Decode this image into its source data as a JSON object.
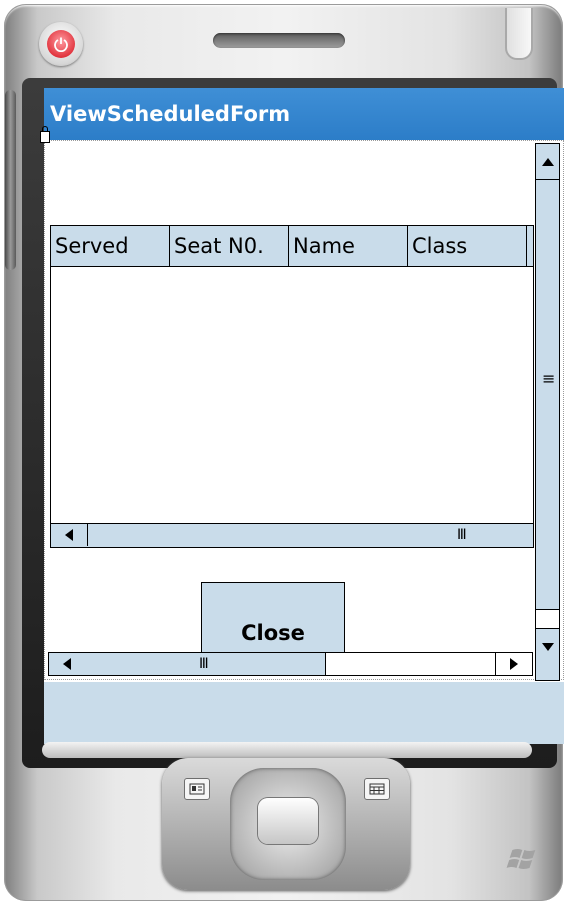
{
  "window": {
    "title": "ViewScheduledForm"
  },
  "grid": {
    "columns": [
      "Served",
      "Seat N0.",
      "Name",
      "Class"
    ],
    "rows": []
  },
  "buttons": {
    "close_label": "Close"
  },
  "icons": {
    "power": "power-icon",
    "lock": "lock-icon",
    "scroll_up": "arrow-up-icon",
    "scroll_down": "arrow-down-icon",
    "scroll_left": "arrow-left-icon",
    "scroll_right": "arrow-right-icon",
    "grip_vertical": "grip-icon",
    "grip_horizontal": "grip-icon",
    "contacts": "contacts-icon",
    "calendar": "calendar-icon",
    "windows": "windows-logo-icon"
  },
  "colors": {
    "titlebar": "#2c7dc8",
    "control_fill": "#c9dcea",
    "power_red": "#e0303a"
  }
}
